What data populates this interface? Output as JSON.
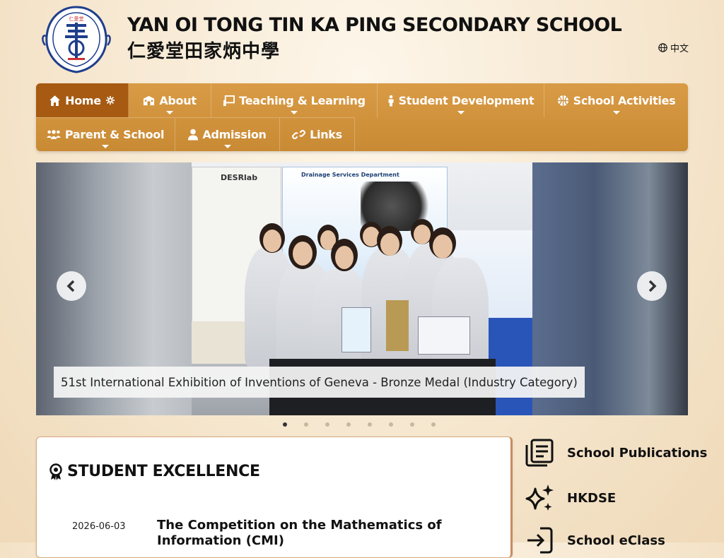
{
  "header": {
    "school_name_en": "YAN OI TONG TIN KA PING SECONDARY SCHOOL",
    "school_name_zh": "仁愛堂田家炳中學",
    "language_toggle": "中文",
    "logo_top_text": "仁愛堂"
  },
  "nav": {
    "items": [
      {
        "label": "Home",
        "icon": "home-icon",
        "active": true
      },
      {
        "label": "About",
        "icon": "school-icon"
      },
      {
        "label": "Teaching & Learning",
        "icon": "chalkboard-icon"
      },
      {
        "label": "Student Development",
        "icon": "person-icon"
      },
      {
        "label": "School Activities",
        "icon": "basketball-icon"
      },
      {
        "label": "Parent & School",
        "icon": "users-icon"
      },
      {
        "label": "Admission",
        "icon": "user-icon"
      },
      {
        "label": "Links",
        "icon": "link-icon"
      }
    ]
  },
  "slider": {
    "caption": "51st International Exhibition of Inventions of Geneva - Bronze Medal (Industry Category)",
    "slide_count": 8,
    "active_index": 0,
    "poster_left_header": "DESRlab",
    "poster_right_header": "Drainage Services Department"
  },
  "student_excellence": {
    "title": "STUDENT EXCELLENCE",
    "items": [
      {
        "date": "2026-06-03",
        "title": "The Competition on the Mathematics of Information (CMI)"
      }
    ]
  },
  "side_links": [
    {
      "label": "School Publications",
      "icon": "book-icon"
    },
    {
      "label": "HKDSE",
      "icon": "sparkles-icon"
    },
    {
      "label": "School eClass",
      "icon": "login-icon"
    }
  ],
  "colors": {
    "nav_bg": "#d99b45",
    "nav_active": "#a65a12",
    "logo_blue": "#1f3f8c"
  }
}
